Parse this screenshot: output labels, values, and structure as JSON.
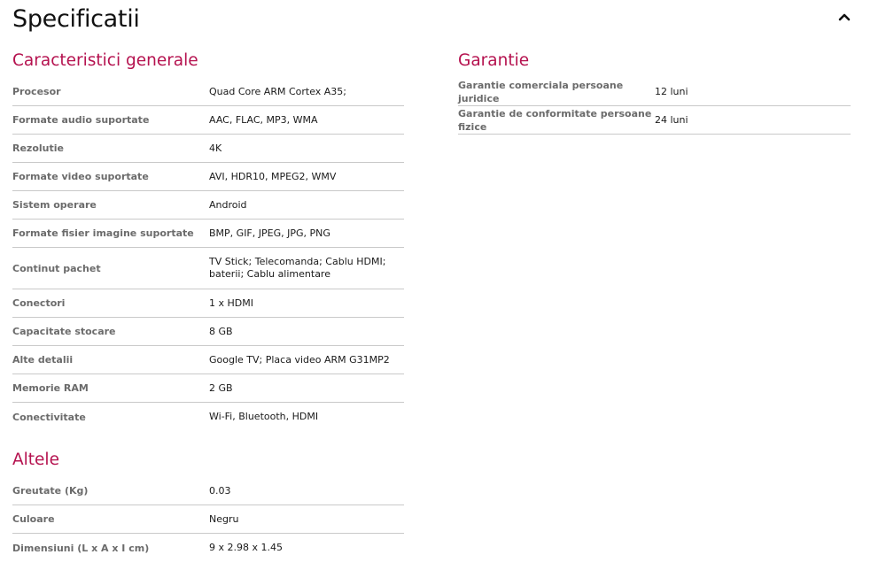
{
  "header": {
    "title": "Specificatii",
    "collapse_icon": "chevron-up-icon"
  },
  "general": {
    "title": "Caracteristici generale",
    "rows": [
      {
        "label": "Procesor",
        "value": "Quad Core ARM Cortex A35;"
      },
      {
        "label": "Formate audio suportate",
        "value": "AAC, FLAC, MP3, WMA"
      },
      {
        "label": "Rezolutie",
        "value": "4K"
      },
      {
        "label": "Formate video suportate",
        "value": "AVI, HDR10, MPEG2, WMV"
      },
      {
        "label": "Sistem operare",
        "value": "Android"
      },
      {
        "label": "Formate fisier imagine suportate",
        "value": "BMP, GIF, JPEG, JPG, PNG"
      },
      {
        "label": "Continut pachet",
        "value": "TV Stick; Telecomanda; Cablu HDMI; baterii; Cablu alimentare"
      },
      {
        "label": "Conectori",
        "value": "1 x HDMI"
      },
      {
        "label": "Capacitate stocare",
        "value": "8 GB"
      },
      {
        "label": "Alte detalii",
        "value": "Google TV; Placa video ARM G31MP2"
      },
      {
        "label": "Memorie RAM",
        "value": "2 GB"
      },
      {
        "label": "Conectivitate",
        "value": "Wi-Fi, Bluetooth, HDMI"
      }
    ]
  },
  "other": {
    "title": "Altele",
    "rows": [
      {
        "label": "Greutate (Kg)",
        "value": "0.03"
      },
      {
        "label": "Culoare",
        "value": "Negru"
      },
      {
        "label": "Dimensiuni (L x A x I cm)",
        "value": "9 x 2.98 x 1.45"
      }
    ]
  },
  "warranty": {
    "title": "Garantie",
    "rows": [
      {
        "label": "Garantie comerciala persoane juridice",
        "value": "12 luni"
      },
      {
        "label": "Garantie de conformitate persoane fizice",
        "value": "24 luni"
      }
    ]
  },
  "colors": {
    "accent": "#b5124f",
    "label": "#6b6b6b",
    "divider": "#c9c9c9"
  }
}
